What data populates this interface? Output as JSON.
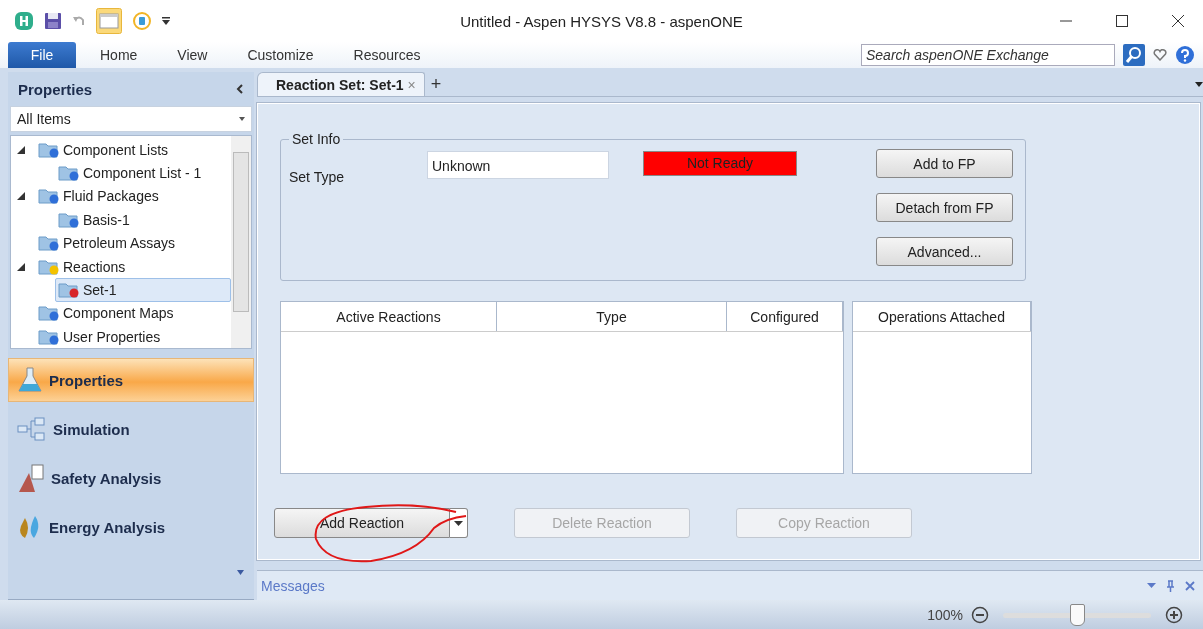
{
  "window": {
    "title": "Untitled - Aspen HYSYS V8.8 - aspenONE"
  },
  "ribbon_tabs": [
    {
      "label": "File",
      "kind": "file"
    },
    {
      "label": "Home",
      "kind": "tab"
    },
    {
      "label": "View",
      "kind": "tab"
    },
    {
      "label": "Customize",
      "kind": "tab"
    },
    {
      "label": "Resources",
      "kind": "tab"
    }
  ],
  "search": {
    "placeholder": "Search aspenONE Exchange"
  },
  "sidebar": {
    "title": "Properties",
    "filter": "All Items",
    "tree": [
      {
        "label": "Component Lists",
        "kind": "ok",
        "expanded": true,
        "selected": false,
        "children": [
          {
            "label": "Component List - 1",
            "kind": "ok",
            "selected": false
          }
        ]
      },
      {
        "label": "Fluid Packages",
        "kind": "ok",
        "expanded": true,
        "selected": false,
        "children": [
          {
            "label": "Basis-1",
            "kind": "ok",
            "selected": false
          }
        ]
      },
      {
        "label": "Petroleum Assays",
        "kind": "ok",
        "selected": false
      },
      {
        "label": "Reactions",
        "kind": "warning",
        "expanded": true,
        "selected": false,
        "children": [
          {
            "label": "Set-1",
            "kind": "error",
            "selected": true
          }
        ]
      },
      {
        "label": "Component Maps",
        "kind": "ok",
        "selected": false
      },
      {
        "label": "User Properties",
        "kind": "ok",
        "selected": false
      }
    ],
    "nav": [
      {
        "label": "Properties",
        "kind": "flask",
        "selected": true
      },
      {
        "label": "Simulation",
        "kind": "flowsheet",
        "selected": false
      },
      {
        "label": "Safety Analysis",
        "kind": "safety",
        "selected": false
      },
      {
        "label": "Energy Analysis",
        "kind": "energy",
        "selected": false
      }
    ]
  },
  "document_tab": {
    "label": "Reaction Set: Set-1",
    "close": "×",
    "add": "+"
  },
  "set_info": {
    "title": "Set Info",
    "set_type_label": "Set Type",
    "set_type": "Unknown",
    "status": "Not Ready",
    "buttons": [
      {
        "label": "Add to FP",
        "disabled": false
      },
      {
        "label": "Detach from FP",
        "disabled": false
      },
      {
        "label": "Advanced...",
        "disabled": false
      }
    ]
  },
  "reactions_table": {
    "columns": [
      "Active Reactions",
      "Type",
      "Configured"
    ]
  },
  "operations_table": {
    "columns": [
      "Operations Attached"
    ]
  },
  "actions": [
    {
      "label": "Add Reaction",
      "disabled": false,
      "dropdown": true
    },
    {
      "label": "Delete Reaction",
      "disabled": true,
      "dropdown": false
    },
    {
      "label": "Copy Reaction",
      "disabled": true,
      "dropdown": false
    }
  ],
  "messages": {
    "title": "Messages"
  },
  "status_bar": {
    "zoom": "100%",
    "zoom_slider": {
      "level": 0.5
    }
  }
}
